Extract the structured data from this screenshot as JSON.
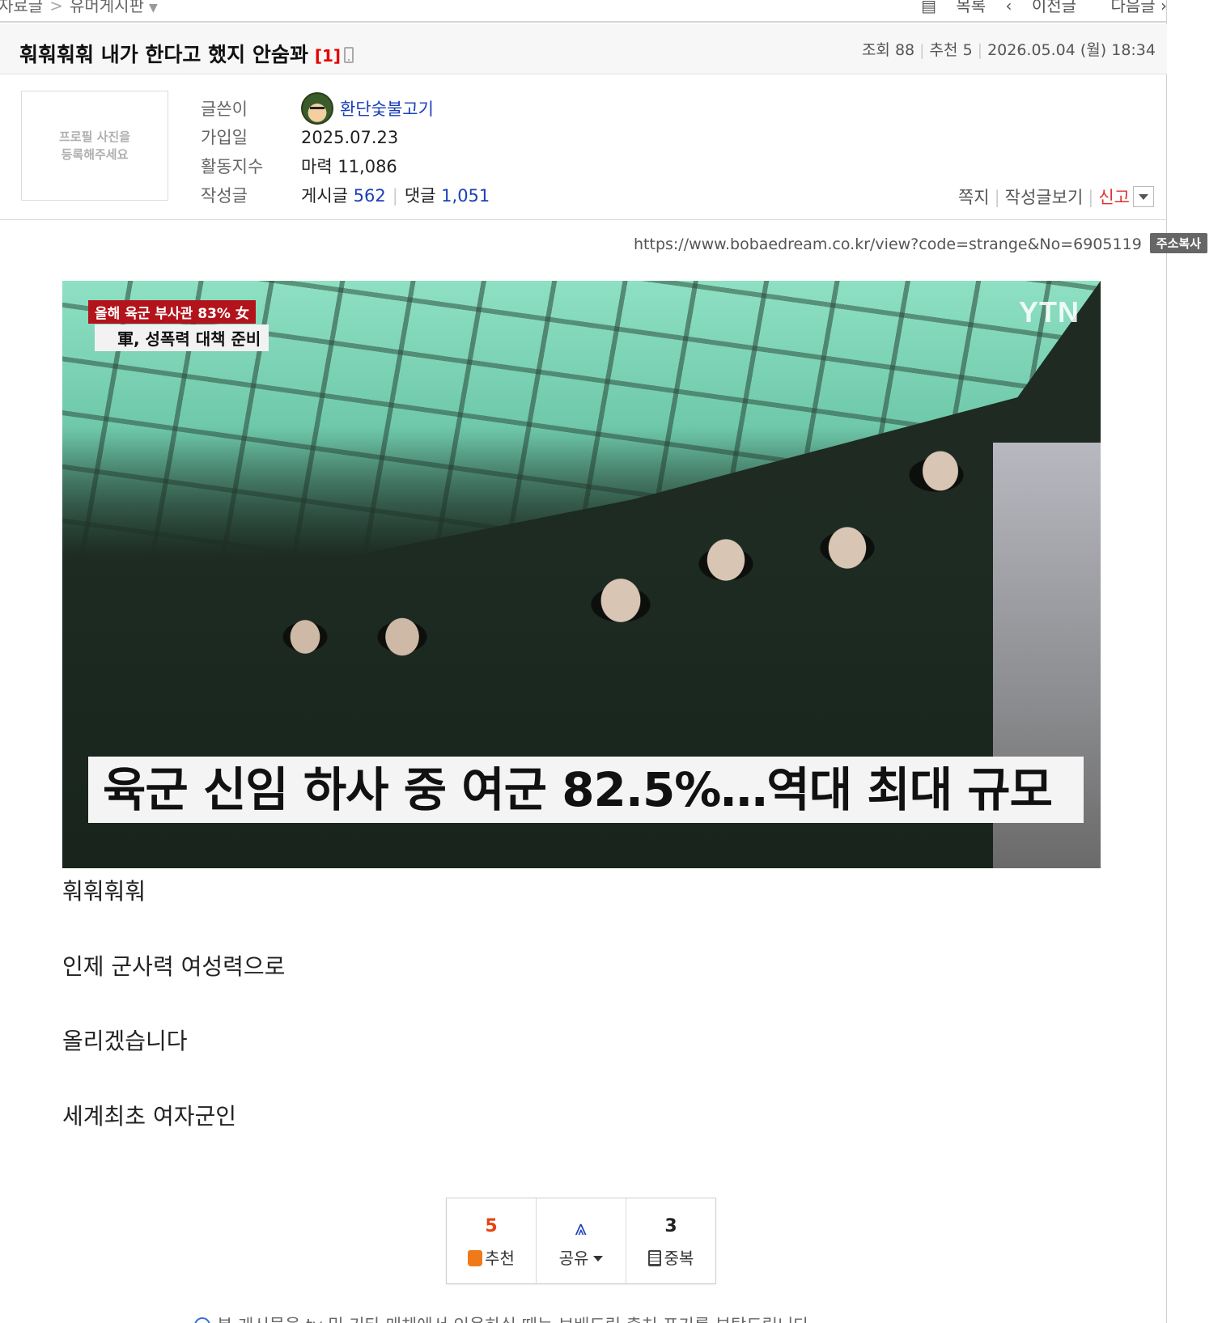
{
  "breadcrumb": {
    "left": [
      "자료글",
      "유머게시판"
    ],
    "right": [
      "목록",
      "이전글",
      "다음글"
    ]
  },
  "post": {
    "title": "훠훠훠훠 내가 한다고 했지 안숨꽈",
    "comment_count": "[1]",
    "views_label": "조회",
    "views": "88",
    "recommend_label": "추천",
    "recommends": "5",
    "datetime": "2026.05.04 (월) 18:34"
  },
  "author": {
    "profile_placeholder_line1": "프로필 사진을",
    "profile_placeholder_line2": "등록해주세요",
    "writer_label": "글쓴이",
    "writer": "환단숯불고기",
    "joined_label": "가입일",
    "joined": "2025.07.23",
    "activity_label": "활동지수",
    "activity": "마력 11,086",
    "posts_label": "작성글",
    "posts_prefix": "게시글",
    "posts_count": "562",
    "comments_prefix": "댓글",
    "comments_count": "1,051",
    "actions": [
      "쪽지",
      "작성글보기",
      "신고"
    ]
  },
  "url": {
    "text": "https://www.bobaedream.co.kr/view?code=strange&No=6905119",
    "copy_label": "주소복사"
  },
  "image": {
    "tag": "올해 육군 부사관 83% 女",
    "sub": "軍, 성폭력 대책 준비",
    "logo": "YTN",
    "headline": "육군 신임 하사 중 여군 82.5%…역대 최대 규모"
  },
  "body": [
    "훠훠훠훠",
    "인제 군사력 여성력으로",
    "올리겠습니다",
    "세계최초 여자군인"
  ],
  "buttons": {
    "recommend_count": "5",
    "recommend_label": "추천",
    "share_label": "공유",
    "duplicate_count": "3",
    "duplicate_label": "중복"
  },
  "notice": "본 게시물을 tv 및 기타 매체에서 인용하실 때는 보배드림 출처 표기를 부탁드립니다."
}
